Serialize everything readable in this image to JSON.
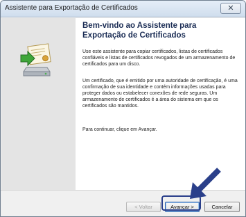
{
  "window": {
    "title": "Assistente para Exportação de Certificados",
    "close_glyph": "✕"
  },
  "content": {
    "heading": "Bem-vindo ao Assistente para Exportação de Certificados",
    "para1": "Use este assistente para copiar certificados, listas de certificados confiáveis e listas de certificados revogados de um armazenamento de certificados para um disco.",
    "para2": "Um certificado, que é emitido por uma autoridade de certificação, é uma confirmação de sua identidade e contém informações usadas para proteger dados ou estabelecer conexões de rede seguras. Um armazenamento de certificados é a área do sistema em que os certificados são mantidos.",
    "para3": "Para continuar, clique em Avançar."
  },
  "buttons": {
    "back": "< Voltar",
    "next": "Avançar >",
    "cancel": "Cancelar"
  },
  "icons": {
    "wizard": "certificate-export-wizard-icon",
    "annotation_arrow": "arrow-icon"
  },
  "colors": {
    "annotation": "#2a3f8a",
    "heading": "#1b2d55"
  }
}
